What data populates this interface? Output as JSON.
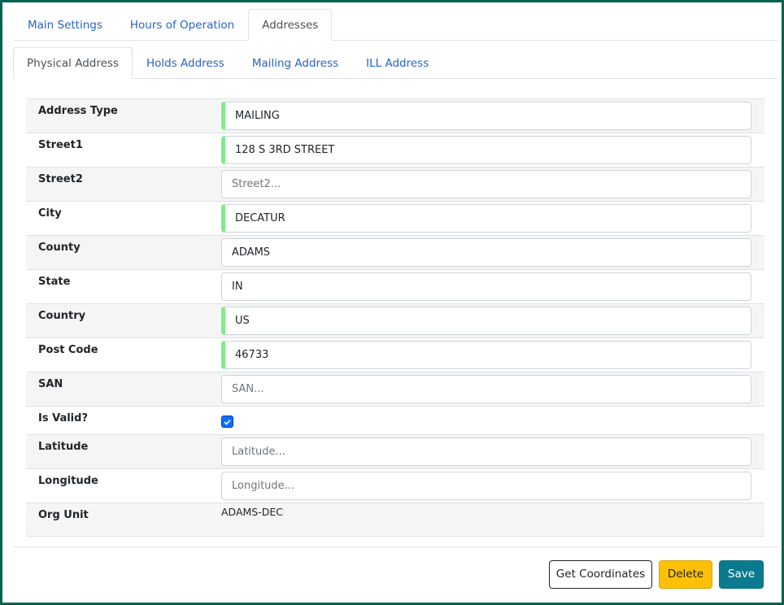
{
  "main_tabs": [
    {
      "label": "Main Settings",
      "active": false
    },
    {
      "label": "Hours of Operation",
      "active": false
    },
    {
      "label": "Addresses",
      "active": true
    }
  ],
  "sub_tabs": [
    {
      "label": "Physical Address",
      "active": true
    },
    {
      "label": "Holds Address",
      "active": false
    },
    {
      "label": "Mailing Address",
      "active": false
    },
    {
      "label": "ILL Address",
      "active": false
    }
  ],
  "form": {
    "address_type": {
      "label": "Address Type",
      "value": "MAILING"
    },
    "street1": {
      "label": "Street1",
      "value": "128 S 3RD STREET"
    },
    "street2": {
      "label": "Street2",
      "value": "",
      "placeholder": "Street2..."
    },
    "city": {
      "label": "City",
      "value": "DECATUR"
    },
    "county": {
      "label": "County",
      "value": "ADAMS"
    },
    "state": {
      "label": "State",
      "value": "IN"
    },
    "country": {
      "label": "Country",
      "value": "US"
    },
    "post_code": {
      "label": "Post Code",
      "value": "46733"
    },
    "san": {
      "label": "SAN",
      "value": "",
      "placeholder": "SAN..."
    },
    "is_valid": {
      "label": "Is Valid?",
      "checked": true
    },
    "latitude": {
      "label": "Latitude",
      "value": "",
      "placeholder": "Latitude..."
    },
    "longitude": {
      "label": "Longitude",
      "value": "",
      "placeholder": "Longitude..."
    },
    "org_unit": {
      "label": "Org Unit",
      "value": "ADAMS-DEC"
    }
  },
  "buttons": {
    "get_coordinates": "Get Coordinates",
    "delete": "Delete",
    "save": "Save"
  },
  "colors": {
    "frame": "#03614f",
    "link": "#2563c9",
    "required_marker": "#7ded8a",
    "checkbox": "#0d6efd",
    "delete": "#ffc107",
    "save": "#0b7a8e"
  }
}
